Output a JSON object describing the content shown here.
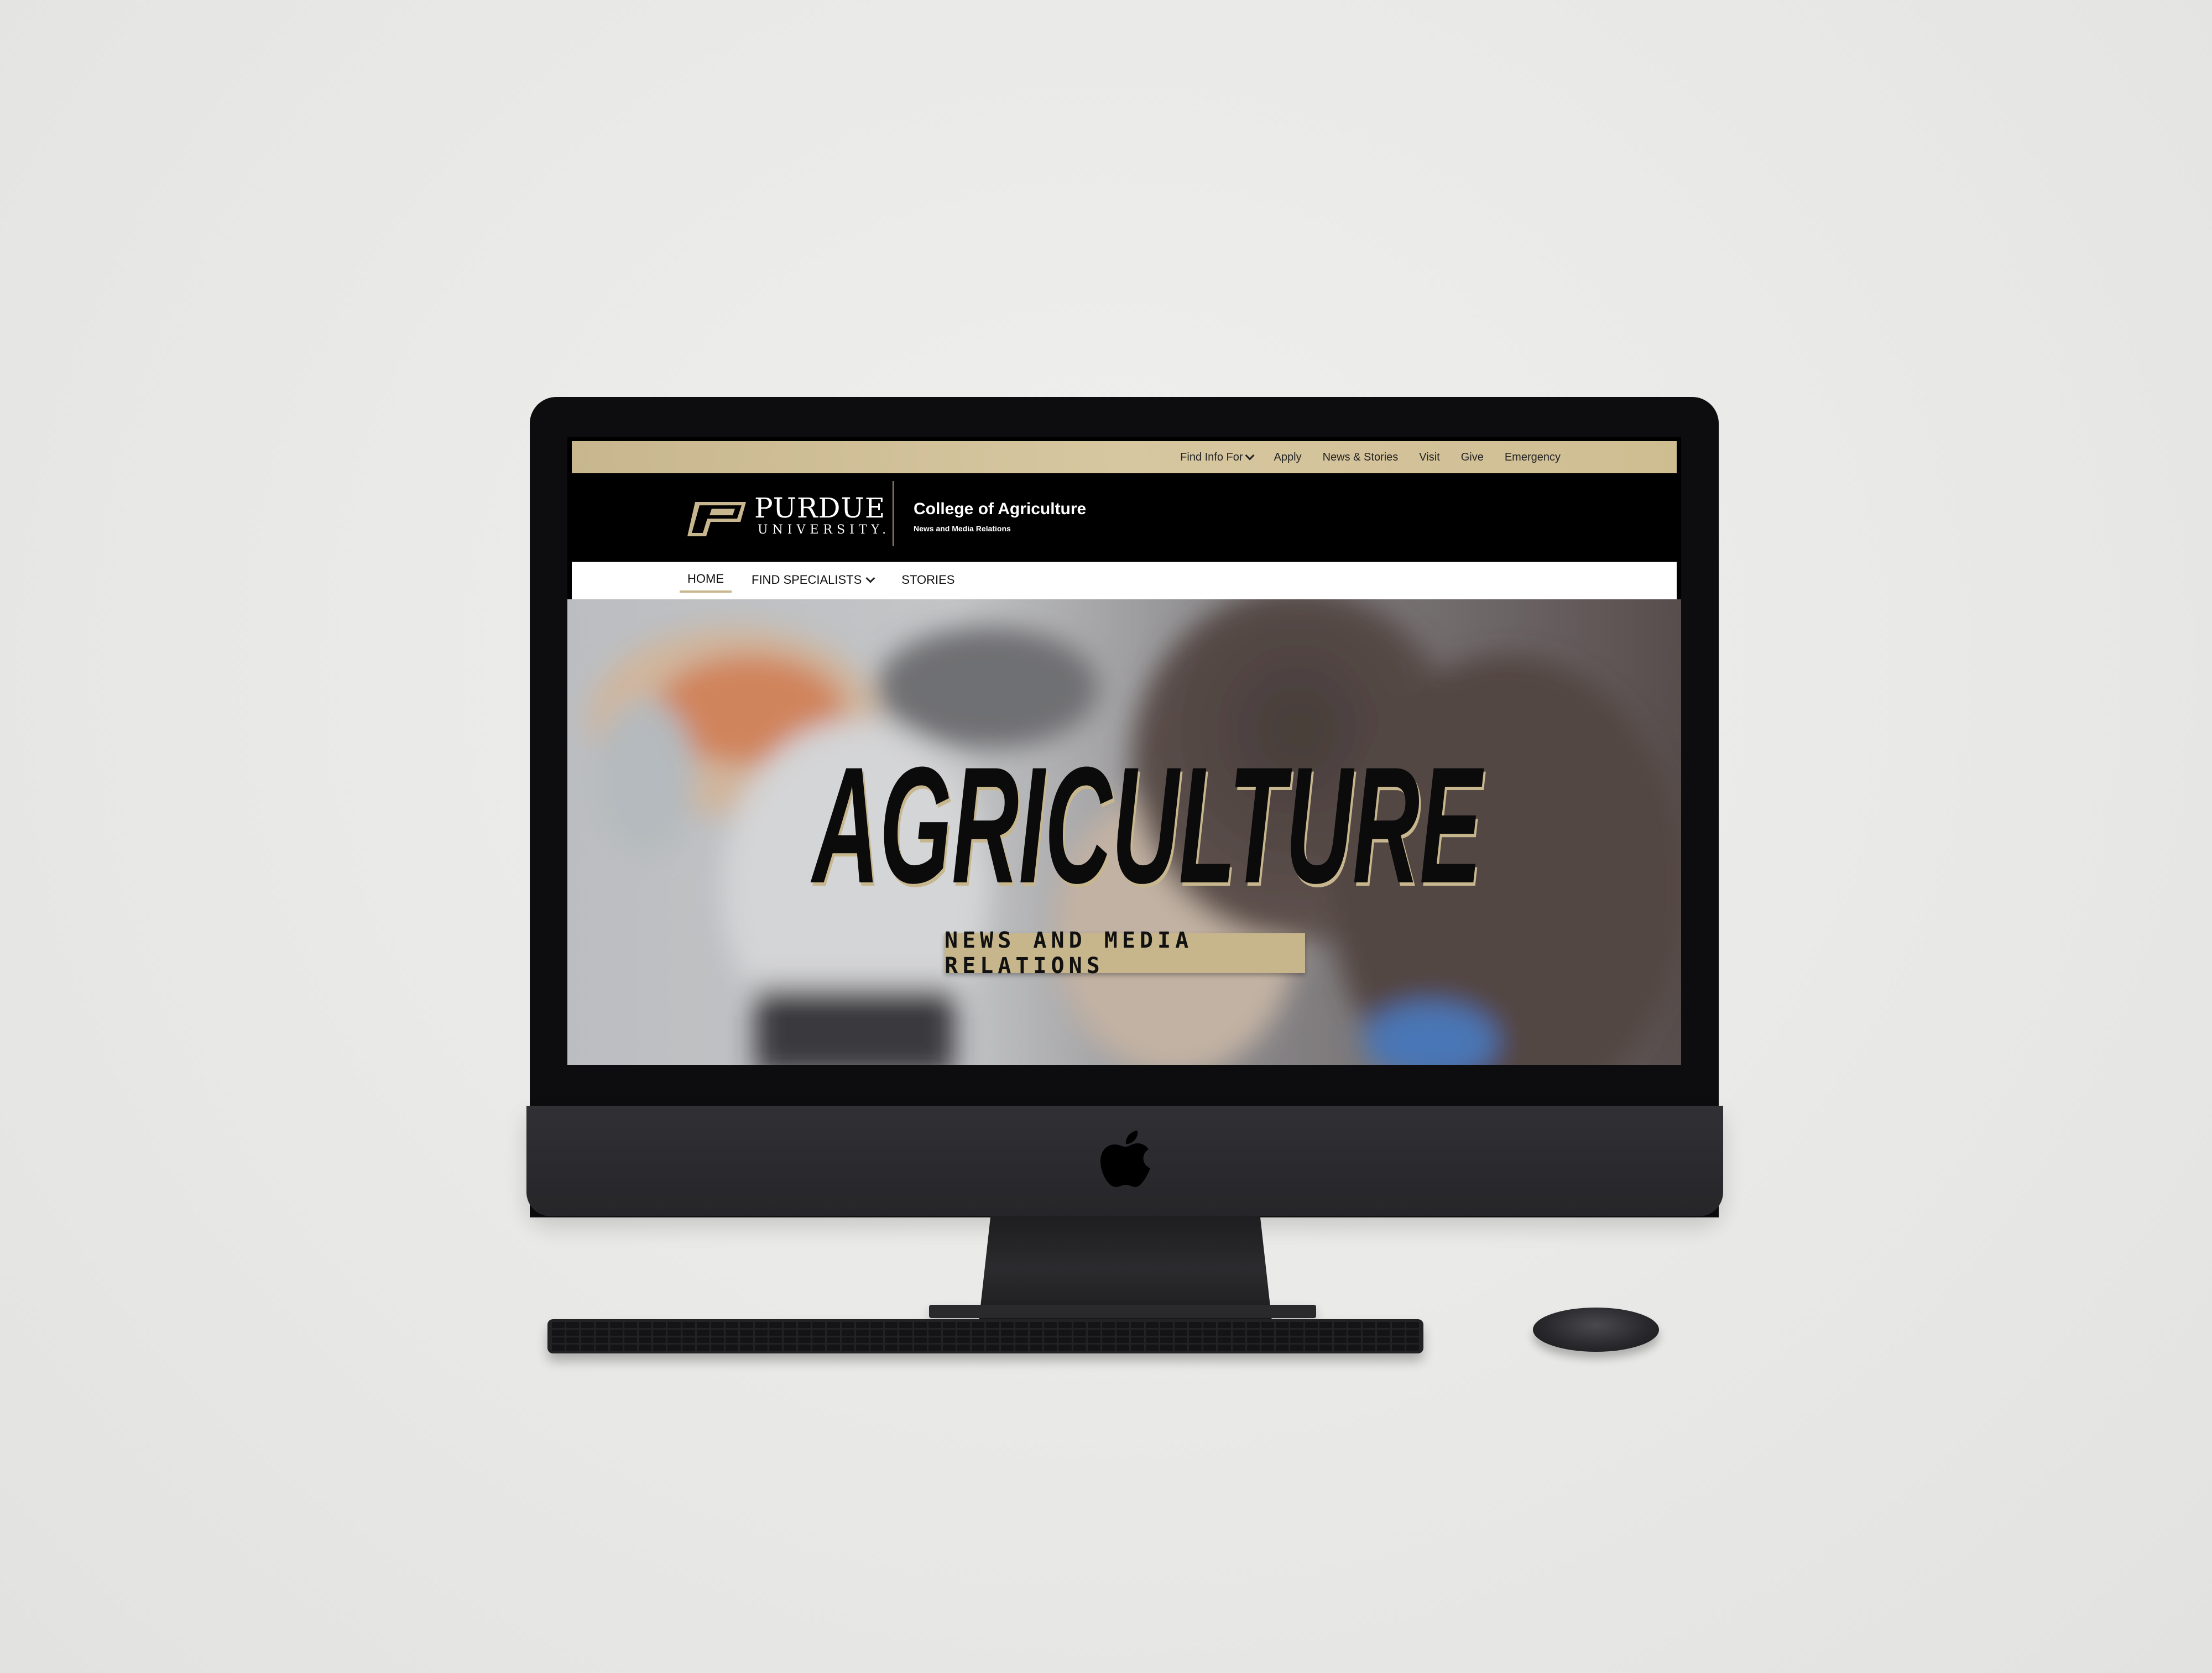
{
  "topbar": {
    "find_info": "Find Info For",
    "apply": "Apply",
    "news": "News & Stories",
    "visit": "Visit",
    "give": "Give",
    "emergency": "Emergency"
  },
  "header": {
    "logo_word": "PURDUE",
    "logo_sub": "UNIVERSITY.",
    "college": "College of Agriculture",
    "subtitle": "News and Media Relations"
  },
  "nav": {
    "home": "HOME",
    "find_specialists": "FIND SPECIALISTS",
    "stories": "STORIES"
  },
  "hero": {
    "title": "AGRICULTURE",
    "badge": "NEWS AND MEDIA RELATIONS"
  },
  "colors": {
    "gold": "#CFB991",
    "black": "#000000",
    "white": "#FFFFFF"
  },
  "icons": [
    "chevron-down-icon",
    "purdue-p-logo",
    "apple-logo-icon"
  ]
}
